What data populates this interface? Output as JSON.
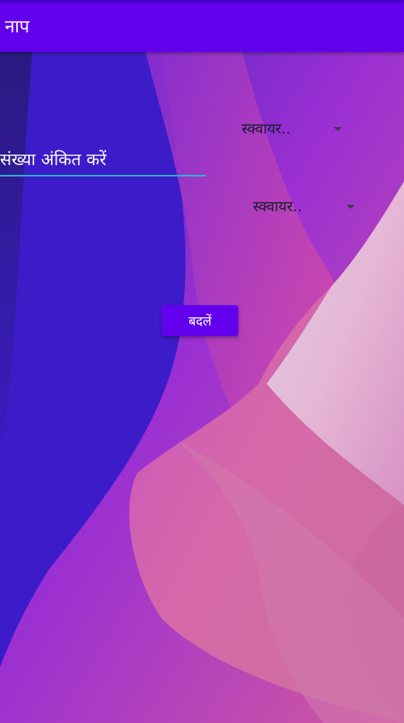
{
  "app_bar": {
    "title": "नाप"
  },
  "converter": {
    "from_unit": {
      "selected": "स्क्वायर..",
      "icon": "dropdown-caret-icon"
    },
    "input": {
      "value": "",
      "placeholder": "संख्या अंकित करें"
    },
    "to_unit": {
      "selected": "स्क्वायर..",
      "icon": "dropdown-caret-icon"
    },
    "convert_label": "बदलें"
  },
  "colors": {
    "primary": "#6200ee",
    "status_bar": "#4a00c8",
    "input_underline": "#26b5c9"
  }
}
